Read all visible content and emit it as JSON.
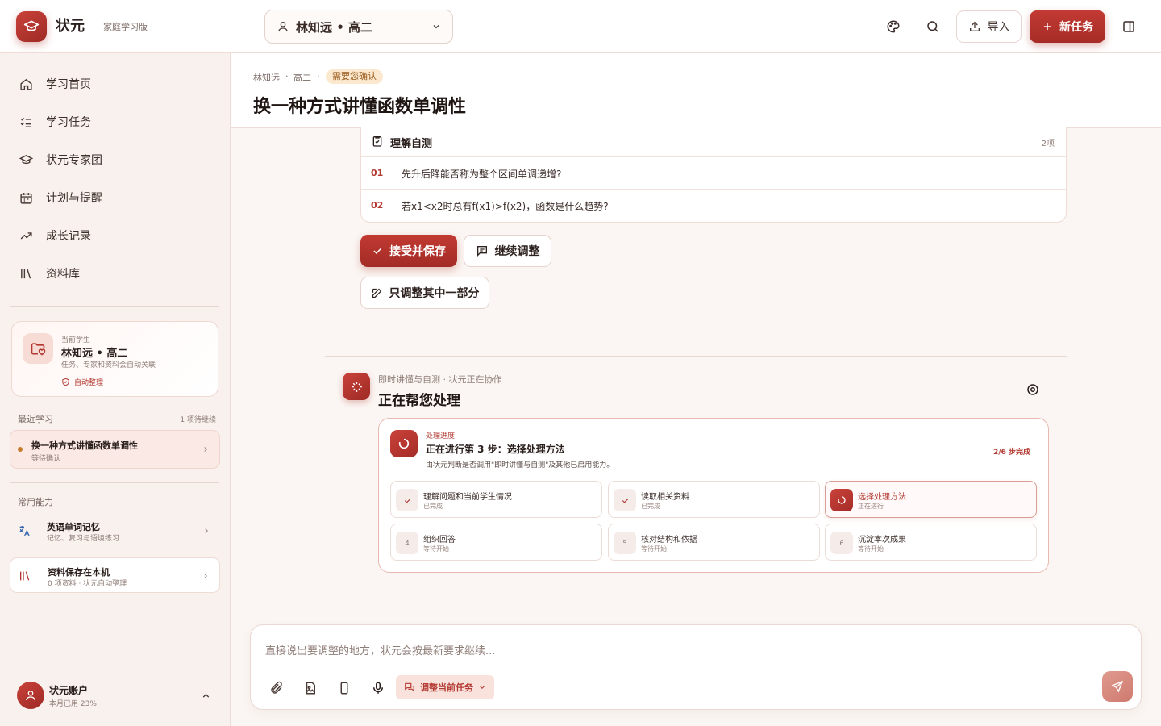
{
  "app": {
    "name": "状元",
    "edition": "家庭学习版"
  },
  "topbar": {
    "student_selector": "林知远 • 高二",
    "import_label": "导入",
    "new_task_label": "新任务"
  },
  "sidebar": {
    "nav": [
      {
        "label": "学习首页",
        "icon": "home-icon"
      },
      {
        "label": "学习任务",
        "icon": "checklist-icon"
      },
      {
        "label": "状元专家团",
        "icon": "graduation-cap-icon"
      },
      {
        "label": "计划与提醒",
        "icon": "calendar-icon"
      },
      {
        "label": "成长记录",
        "icon": "trend-icon"
      },
      {
        "label": "资料库",
        "icon": "library-icon"
      }
    ],
    "current_student": {
      "caption": "当前学生",
      "name": "林知远 • 高二",
      "desc": "任务、专家和资料会自动关联",
      "auto_label": "自动整理"
    },
    "recent": {
      "label": "最近学习",
      "meta": "1 项待继续",
      "items": [
        {
          "title": "换一种方式讲懂函数单调性",
          "status": "等待确认"
        }
      ]
    },
    "abilities": {
      "label": "常用能力",
      "items": [
        {
          "title": "英语单词记忆",
          "desc": "记忆、复习与语境练习",
          "icon": "translate-icon"
        },
        {
          "title": "资料保存在本机",
          "desc": "0 项资料 · 状元自动整理",
          "icon": "library-icon"
        }
      ]
    },
    "account": {
      "name": "状元账户",
      "usage": "本月已用 23%"
    }
  },
  "main": {
    "breadcrumb": [
      "林知远",
      "高二"
    ],
    "badge": "需要您确认",
    "title": "换一种方式讲懂函数单调性",
    "quiz": {
      "title": "理解自测",
      "count": "2项",
      "items": [
        {
          "num": "01",
          "text": "先升后降能否称为整个区间单调递增?"
        },
        {
          "num": "02",
          "text": "若x1<x2时总有f(x1)>f(x2)，函数是什么趋势?"
        }
      ]
    },
    "actions": {
      "accept": "接受并保存",
      "continue": "继续调整",
      "partial": "只调整其中一部分"
    },
    "agent": {
      "caption": "即时讲懂与自测 · 状元正在协作",
      "title": "正在帮您处理"
    },
    "progress": {
      "label": "处理进度",
      "title": "正在进行第 3 步：选择处理方法",
      "desc": "由状元判断是否调用\"即时讲懂与自测\"及其他已启用能力。",
      "count": "2/6 步完成",
      "steps": [
        {
          "n": "",
          "title": "理解问题和当前学生情况",
          "status": "已完成",
          "state": "done"
        },
        {
          "n": "",
          "title": "读取相关资料",
          "status": "已完成",
          "state": "done"
        },
        {
          "n": "",
          "title": "选择处理方法",
          "status": "正在进行",
          "state": "active"
        },
        {
          "n": "4",
          "title": "组织回答",
          "status": "等待开始",
          "state": "pending"
        },
        {
          "n": "5",
          "title": "核对结构和依据",
          "status": "等待开始",
          "state": "pending"
        },
        {
          "n": "6",
          "title": "沉淀本次成果",
          "status": "等待开始",
          "state": "pending"
        }
      ]
    },
    "composer": {
      "placeholder": "直接说出要调整的地方，状元会按最新要求继续...",
      "value": "",
      "mode": "调整当前任务"
    }
  },
  "colors": {
    "brand": "#b33a32",
    "background": "#fbf6f3",
    "badge_bg": "#fbe8cf"
  }
}
